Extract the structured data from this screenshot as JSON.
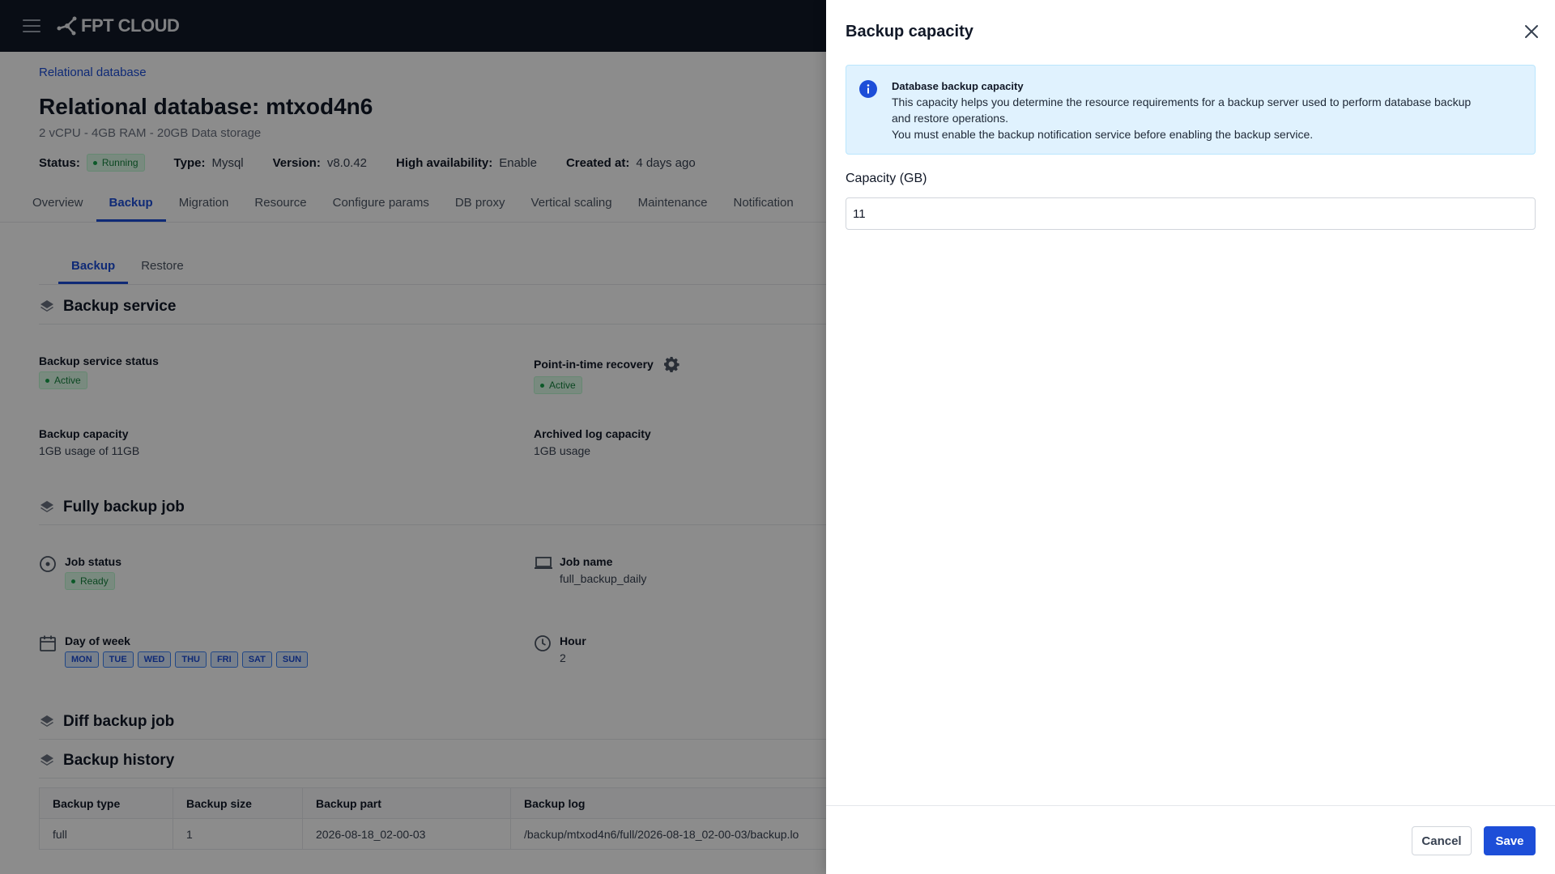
{
  "topbar": {
    "logo_text": "FPT CLOUD"
  },
  "page": {
    "breadcrumb": "Relational database",
    "title": "Relational database: mtxod4n6",
    "subtitle": "2 vCPU - 4GB RAM - 20GB Data storage",
    "meta": {
      "status_label": "Status:",
      "status_value": "Running",
      "type_label": "Type:",
      "type_value": "Mysql",
      "version_label": "Version:",
      "version_value": "v8.0.42",
      "ha_label": "High availability:",
      "ha_value": "Enable",
      "created_label": "Created at:",
      "created_value": "4 days ago"
    },
    "tabs": [
      "Overview",
      "Backup",
      "Migration",
      "Resource",
      "Configure params",
      "DB proxy",
      "Vertical scaling",
      "Maintenance",
      "Notification"
    ],
    "subtabs": [
      "Backup",
      "Restore"
    ],
    "backup_service": {
      "heading": "Backup service",
      "status_label": "Backup service status",
      "status_value": "Active",
      "pitr_label": "Point-in-time recovery",
      "pitr_value": "Active",
      "capacity_label": "Backup capacity",
      "capacity_value": "1GB usage of 11GB",
      "archived_label": "Archived log capacity",
      "archived_value": "1GB usage"
    },
    "full_backup": {
      "heading": "Fully backup job",
      "job_status_label": "Job status",
      "job_status_value": "Ready",
      "job_name_label": "Job name",
      "job_name_value": "full_backup_daily",
      "dow_label": "Day of week",
      "days": [
        "MON",
        "TUE",
        "WED",
        "THU",
        "FRI",
        "SAT",
        "SUN"
      ],
      "hour_label": "Hour",
      "hour_value": "2"
    },
    "diff_backup": {
      "heading": "Diff backup job"
    },
    "history": {
      "heading": "Backup history",
      "columns": [
        "Backup type",
        "Backup size",
        "Backup part",
        "Backup log"
      ],
      "rows": [
        [
          "full",
          "1",
          "2026-08-18_02-00-03",
          "/backup/mtxod4n6/full/2026-08-18_02-00-03/backup.lo"
        ]
      ]
    }
  },
  "drawer": {
    "title": "Backup capacity",
    "alert": {
      "title": "Database backup capacity",
      "line1": "This capacity helps you determine the resource requirements for a backup server used to perform database backup",
      "line2": "and restore operations.",
      "line3": "You must enable the backup notification service before enabling the backup service."
    },
    "capacity_label": "Capacity (GB)",
    "capacity_value": "11",
    "cancel_label": "Cancel",
    "save_label": "Save"
  }
}
